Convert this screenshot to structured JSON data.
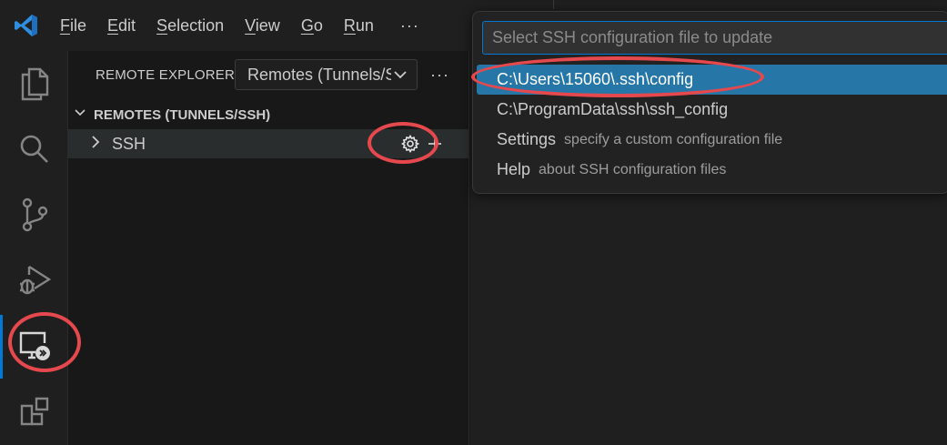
{
  "menu": {
    "items": [
      {
        "underline": "F",
        "rest": "ile"
      },
      {
        "underline": "E",
        "rest": "dit"
      },
      {
        "underline": "S",
        "rest": "election"
      },
      {
        "underline": "V",
        "rest": "iew"
      },
      {
        "underline": "G",
        "rest": "o"
      },
      {
        "underline": "R",
        "rest": "un"
      }
    ],
    "more": "···"
  },
  "activity": {
    "icons": [
      "explorer-icon",
      "search-icon",
      "source-control-icon",
      "run-debug-icon",
      "remote-explorer-icon",
      "extensions-icon"
    ],
    "active": "remote-explorer-icon"
  },
  "sidebar": {
    "title": "REMOTE EXPLORER",
    "select_value": "Remotes (Tunnels/SSH)",
    "more": "···",
    "section_title": "REMOTES (TUNNELS/SSH)",
    "tree_item": "SSH"
  },
  "quickpick": {
    "placeholder": "Select SSH configuration file to update",
    "items": [
      {
        "label": "C:\\Users\\15060\\.ssh\\config",
        "description": ""
      },
      {
        "label": "C:\\ProgramData\\ssh\\ssh_config",
        "description": ""
      },
      {
        "label": "Settings",
        "description": "specify a custom configuration file"
      },
      {
        "label": "Help",
        "description": "about SSH configuration files"
      }
    ],
    "selected_index": 0
  },
  "colors": {
    "accent": "#0078d4",
    "selection": "#2677a8",
    "annotation": "#e5484d"
  }
}
